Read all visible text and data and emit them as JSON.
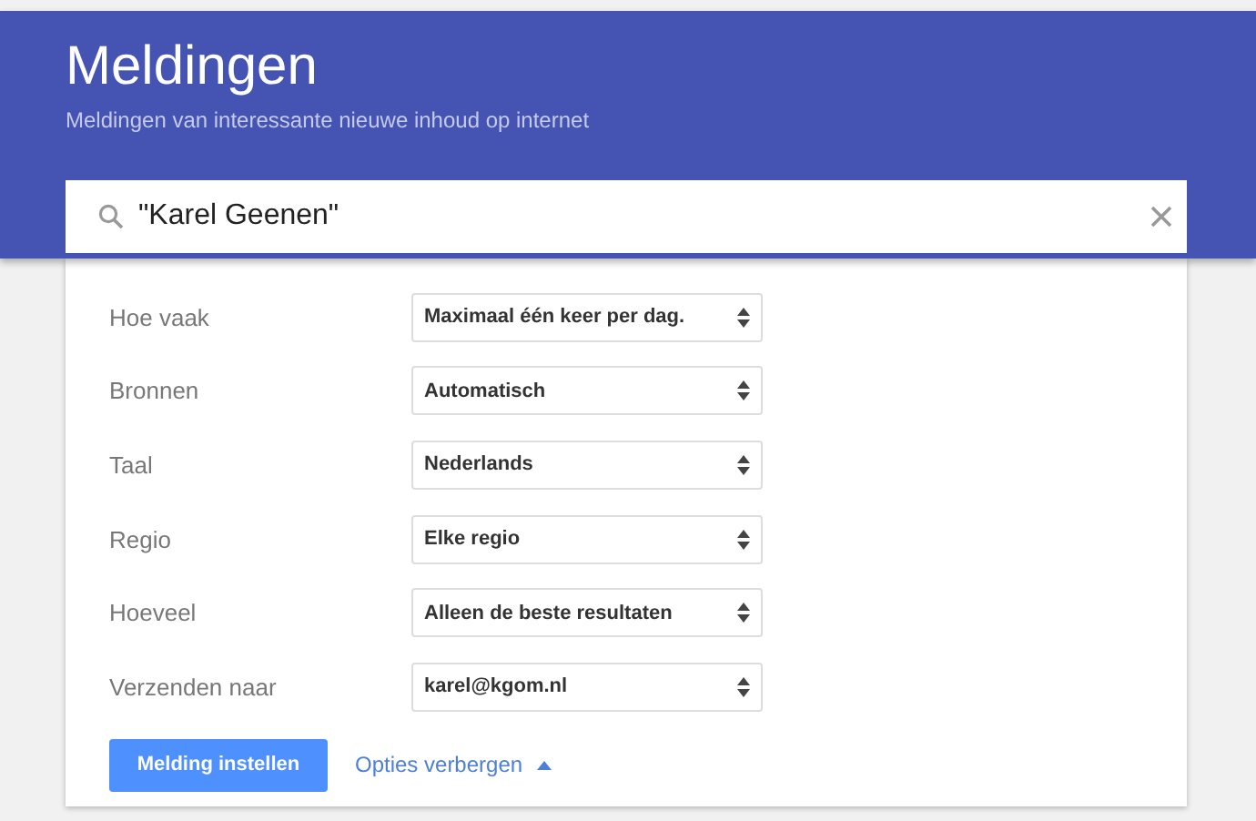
{
  "header": {
    "title": "Meldingen",
    "subtitle": "Meldingen van interessante nieuwe inhoud op internet"
  },
  "search": {
    "value": "\"Karel Geenen\""
  },
  "options": [
    {
      "label": "Hoe vaak",
      "value": "Maximaal één keer per dag."
    },
    {
      "label": "Bronnen",
      "value": "Automatisch"
    },
    {
      "label": "Taal",
      "value": "Nederlands"
    },
    {
      "label": "Regio",
      "value": "Elke regio"
    },
    {
      "label": "Hoeveel",
      "value": "Alleen de beste resultaten"
    },
    {
      "label": "Verzenden naar",
      "value": "karel@kgom.nl"
    }
  ],
  "create_button": "Melding instellen",
  "toggle_link": {
    "label": "Opties verbergen",
    "expanded": true
  }
}
